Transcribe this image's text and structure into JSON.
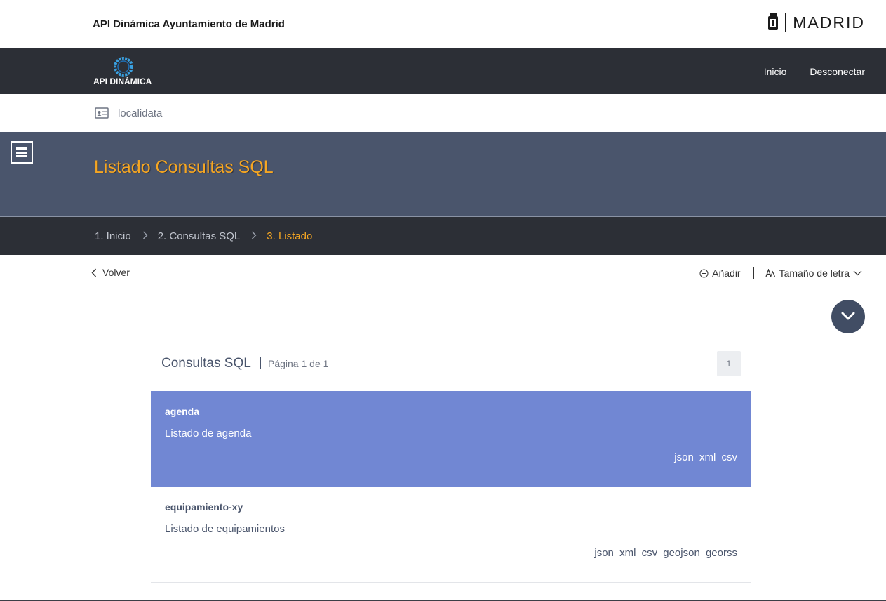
{
  "header": {
    "site_title": "API Dinámica Ayuntamiento de Madrid",
    "city_logo_text": "MADRID"
  },
  "navbar": {
    "brand_text": "API DINÁMICA",
    "links": [
      "Inicio",
      "Desconectar"
    ]
  },
  "context": {
    "icon": "id-card-icon",
    "label": "localidata"
  },
  "hero": {
    "title": "Listado Consultas SQL"
  },
  "breadcrumb": [
    "1. Inicio",
    "2. Consultas SQL",
    "3. Listado"
  ],
  "toolbar": {
    "back_label": "Volver",
    "add_label": "Añadir",
    "font_size_label": "Tamaño de letra"
  },
  "list": {
    "title": "Consultas SQL",
    "page_info": "Página 1 de 1",
    "current_page": "1",
    "items": [
      {
        "name": "agenda",
        "description": "Listado de agenda",
        "formats": [
          "json",
          "xml",
          "csv"
        ]
      },
      {
        "name": "equipamiento-xy",
        "description": "Listado de equipamientos",
        "formats": [
          "json",
          "xml",
          "csv",
          "geojson",
          "georss"
        ]
      }
    ]
  },
  "colors": {
    "accent": "#f5a623",
    "navbar": "#2c2f36",
    "hero": "#4a556c",
    "active_row": "#7187d3"
  }
}
